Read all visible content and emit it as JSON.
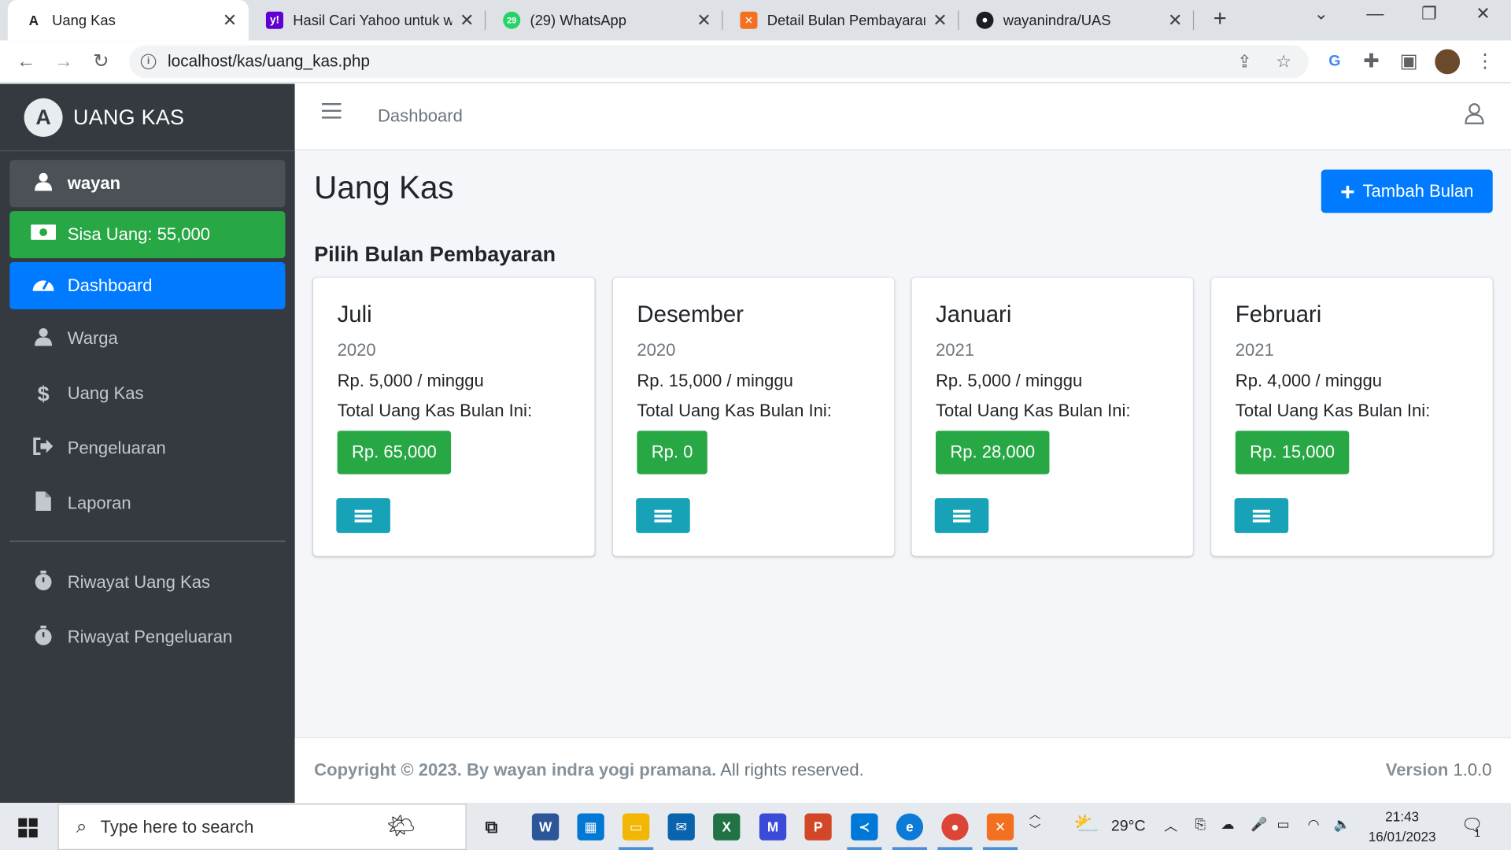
{
  "browser": {
    "tabs": [
      {
        "title": "Uang Kas",
        "favicon": "A",
        "active": true
      },
      {
        "title": "Hasil Cari Yahoo untuk wa",
        "favicon": "y!"
      },
      {
        "title": "(29) WhatsApp",
        "favicon": "29"
      },
      {
        "title": "Detail Bulan Pembayaran",
        "favicon": "xampp-icon"
      },
      {
        "title": "wayanindra/UAS",
        "favicon": "github-icon"
      }
    ],
    "url": "localhost/kas/uang_kas.php"
  },
  "sidebar": {
    "brand": "UANG KAS",
    "user": "wayan",
    "balance": "Sisa Uang: 55,000",
    "items": [
      {
        "label": "Dashboard",
        "icon": "tachometer-icon"
      },
      {
        "label": "Warga",
        "icon": "users-icon"
      },
      {
        "label": "Uang Kas",
        "icon": "dollar-icon"
      },
      {
        "label": "Pengeluaran",
        "icon": "sign-out-icon"
      },
      {
        "label": "Laporan",
        "icon": "file-icon"
      }
    ],
    "history": [
      {
        "label": "Riwayat Uang Kas",
        "icon": "stopwatch-icon"
      },
      {
        "label": "Riwayat Pengeluaran",
        "icon": "stopwatch-icon"
      }
    ]
  },
  "topnav": {
    "breadcrumb": "Dashboard"
  },
  "main": {
    "title": "Uang Kas",
    "add_button": "Tambah Bulan",
    "section_title": "Pilih Bulan Pembayaran",
    "cards": [
      {
        "month": "Juli",
        "year": "2020",
        "rate": "Rp. 5,000 / minggu",
        "total_label": "Total Uang Kas Bulan Ini:",
        "total": "Rp. 65,000"
      },
      {
        "month": "Desember",
        "year": "2020",
        "rate": "Rp. 15,000 / minggu",
        "total_label": "Total Uang Kas Bulan Ini:",
        "total": "Rp. 0"
      },
      {
        "month": "Januari",
        "year": "2021",
        "rate": "Rp. 5,000 / minggu",
        "total_label": "Total Uang Kas Bulan Ini:",
        "total": "Rp. 28,000"
      },
      {
        "month": "Februari",
        "year": "2021",
        "rate": "Rp. 4,000 / minggu",
        "total_label": "Total Uang Kas Bulan Ini:",
        "total": "Rp. 15,000"
      }
    ]
  },
  "footer": {
    "copyright_bold": "Copyright © 2023. By wayan indra yogi pramana.",
    "copyright_rest": " All rights reserved.",
    "version_label": "Version",
    "version": " 1.0.0"
  },
  "taskbar": {
    "search_placeholder": "Type here to search",
    "weather": "29°C",
    "time": "21:43",
    "date": "16/01/2023",
    "notifications": "1"
  },
  "colors": {
    "sidebar_bg": "#343a40",
    "primary": "#007bff",
    "success": "#28a745",
    "info": "#17a2b8"
  }
}
